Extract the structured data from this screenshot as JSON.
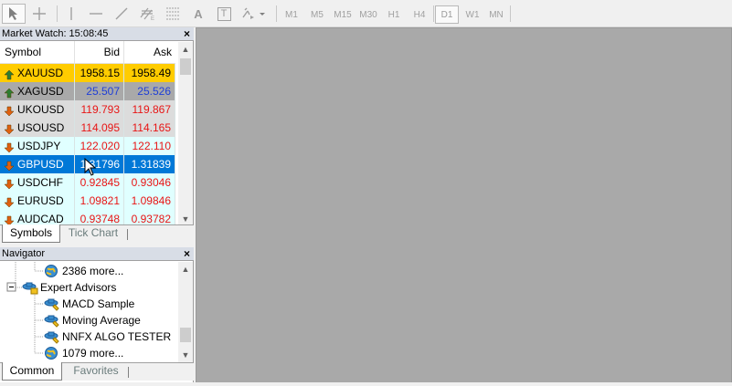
{
  "toolbar": {
    "timeframes": [
      "M1",
      "M5",
      "M15",
      "M30",
      "H1",
      "H4",
      "D1",
      "W1",
      "MN"
    ],
    "active_timeframe": "D1",
    "tool_text_label": "A",
    "tool_textlabel_label": "T"
  },
  "market_watch": {
    "title": "Market Watch: 15:08:45",
    "columns": {
      "symbol": "Symbol",
      "bid": "Bid",
      "ask": "Ask"
    },
    "rows": [
      {
        "symbol": "XAUUSD",
        "bid": "1958.15",
        "ask": "1958.49",
        "direction": "up",
        "bg": "#ffcc00",
        "color": "#000000"
      },
      {
        "symbol": "XAGUSD",
        "bid": "25.507",
        "ask": "25.526",
        "direction": "up",
        "bg": "#a9a9a9",
        "color": "#1f3fd6"
      },
      {
        "symbol": "UKOUSD",
        "bid": "119.793",
        "ask": "119.867",
        "direction": "down",
        "bg": "#dcdcdc",
        "color": "#e81515"
      },
      {
        "symbol": "USOUSD",
        "bid": "114.095",
        "ask": "114.165",
        "direction": "down",
        "bg": "#dcdcdc",
        "color": "#e81515"
      },
      {
        "symbol": "USDJPY",
        "bid": "122.020",
        "ask": "122.110",
        "direction": "down",
        "bg": "#e0ffff",
        "color": "#e81515"
      },
      {
        "symbol": "GBPUSD",
        "bid": "1.31796",
        "ask": "1.31839",
        "direction": "down",
        "bg": "#0078d7",
        "color": "#ffffff"
      },
      {
        "symbol": "USDCHF",
        "bid": "0.92845",
        "ask": "0.93046",
        "direction": "down",
        "bg": "#e0ffff",
        "color": "#e81515"
      },
      {
        "symbol": "EURUSD",
        "bid": "1.09821",
        "ask": "1.09846",
        "direction": "down",
        "bg": "#e0ffff",
        "color": "#e81515"
      },
      {
        "symbol": "AUDCAD",
        "bid": "0.93748",
        "ask": "0.93782",
        "direction": "down",
        "bg": "#e0ffff",
        "color": "#e81515"
      }
    ],
    "tabs": [
      "Symbols",
      "Tick Chart"
    ]
  },
  "navigator": {
    "title": "Navigator",
    "items": [
      {
        "label": "2386 more...",
        "icon": "globe-icon",
        "level": 2
      },
      {
        "label": "Expert Advisors",
        "icon": "expert-advisors-icon",
        "level": 1
      },
      {
        "label": "MACD Sample",
        "icon": "expert-icon",
        "level": 2
      },
      {
        "label": "Moving Average",
        "icon": "expert-icon",
        "level": 2
      },
      {
        "label": "NNFX ALGO TESTER",
        "icon": "expert-icon",
        "level": 2
      },
      {
        "label": "1079 more...",
        "icon": "globe-icon",
        "level": 2
      }
    ],
    "tabs": [
      "Common",
      "Favorites"
    ]
  },
  "colors": {
    "up_arrow": "#2e7d32",
    "down_arrow": "#e06010",
    "selection": "#0078d7",
    "chart_bg": "#a9a9a9"
  }
}
